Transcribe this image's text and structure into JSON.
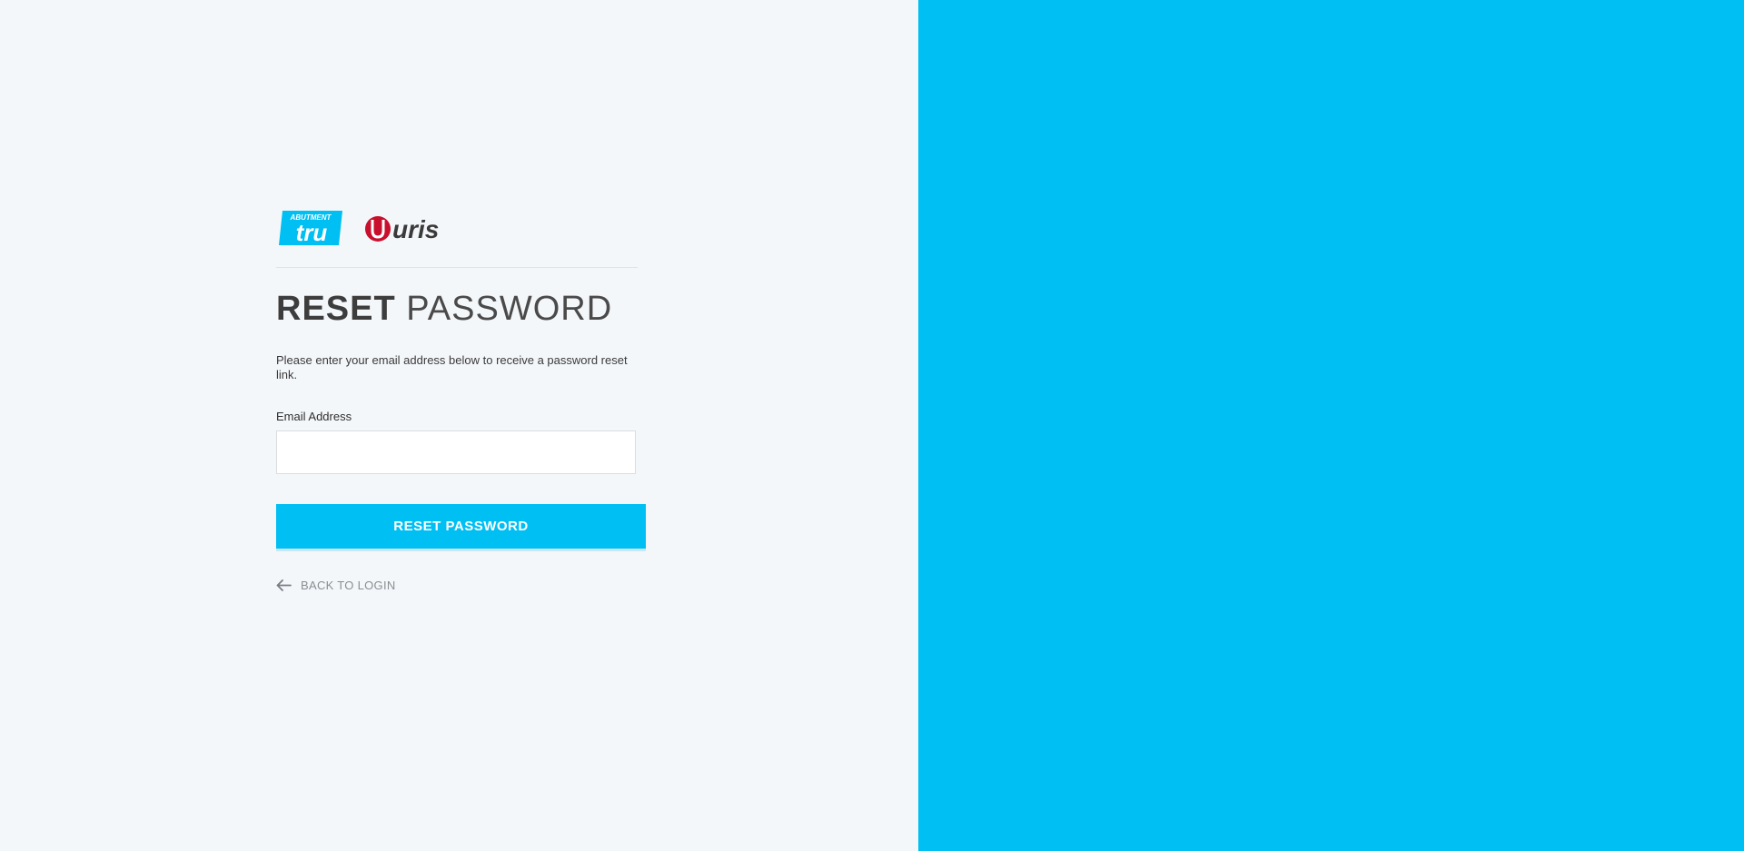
{
  "logos": {
    "tru_text": "ABUTMENT tru",
    "uris_text": "uris"
  },
  "heading": {
    "bold": "RESET",
    "light": "PASSWORD"
  },
  "description": "Please enter your email address below to receive a password reset link.",
  "email": {
    "label": "Email Address",
    "value": "",
    "placeholder": ""
  },
  "reset_button_label": "RESET PASSWORD",
  "back_link_label": "BACK TO LOGIN",
  "colors": {
    "accent": "#00bff3",
    "left_bg": "#f4f7fa",
    "uris_red": "#c8102e",
    "uris_dark": "#3a3a3a"
  },
  "icons": {
    "back": "arrow-left-icon"
  }
}
